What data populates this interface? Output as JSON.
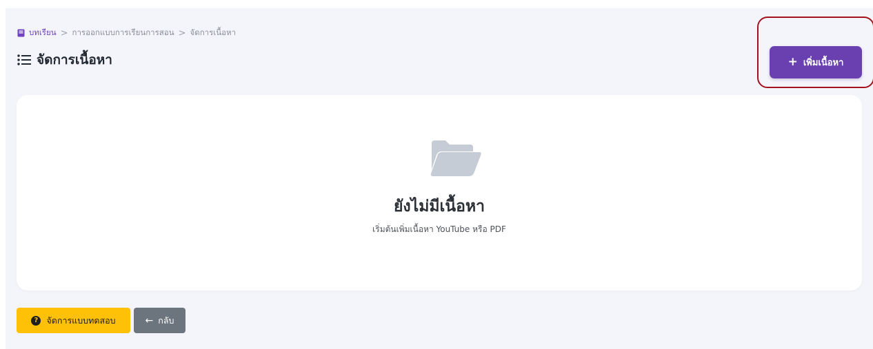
{
  "breadcrumb": {
    "items": [
      "บทเรียน",
      "การออกแบบการเรียนการสอน",
      "จัดการเนื้อหา"
    ],
    "separator": ">"
  },
  "header": {
    "title": "จัดการเนื้อหา",
    "add_button_label": "เพิ่มเนื้อหา",
    "add_button_icon": "+"
  },
  "empty_state": {
    "title": "ยังไม่มีเนื้อหา",
    "subtitle": "เริ่มต้นเพิ่มเนื้อหา YouTube หรือ PDF",
    "icon": "folder-open-icon"
  },
  "footer": {
    "quiz_button_label": "จัดการแบบทดสอบ",
    "quiz_icon_glyph": "?",
    "back_button_label": "กลับ",
    "back_icon_glyph": "←"
  },
  "colors": {
    "primary": "#6a3fb0",
    "warning": "#ffc107",
    "secondary": "#6c757d",
    "highlight": "#a3121c"
  }
}
